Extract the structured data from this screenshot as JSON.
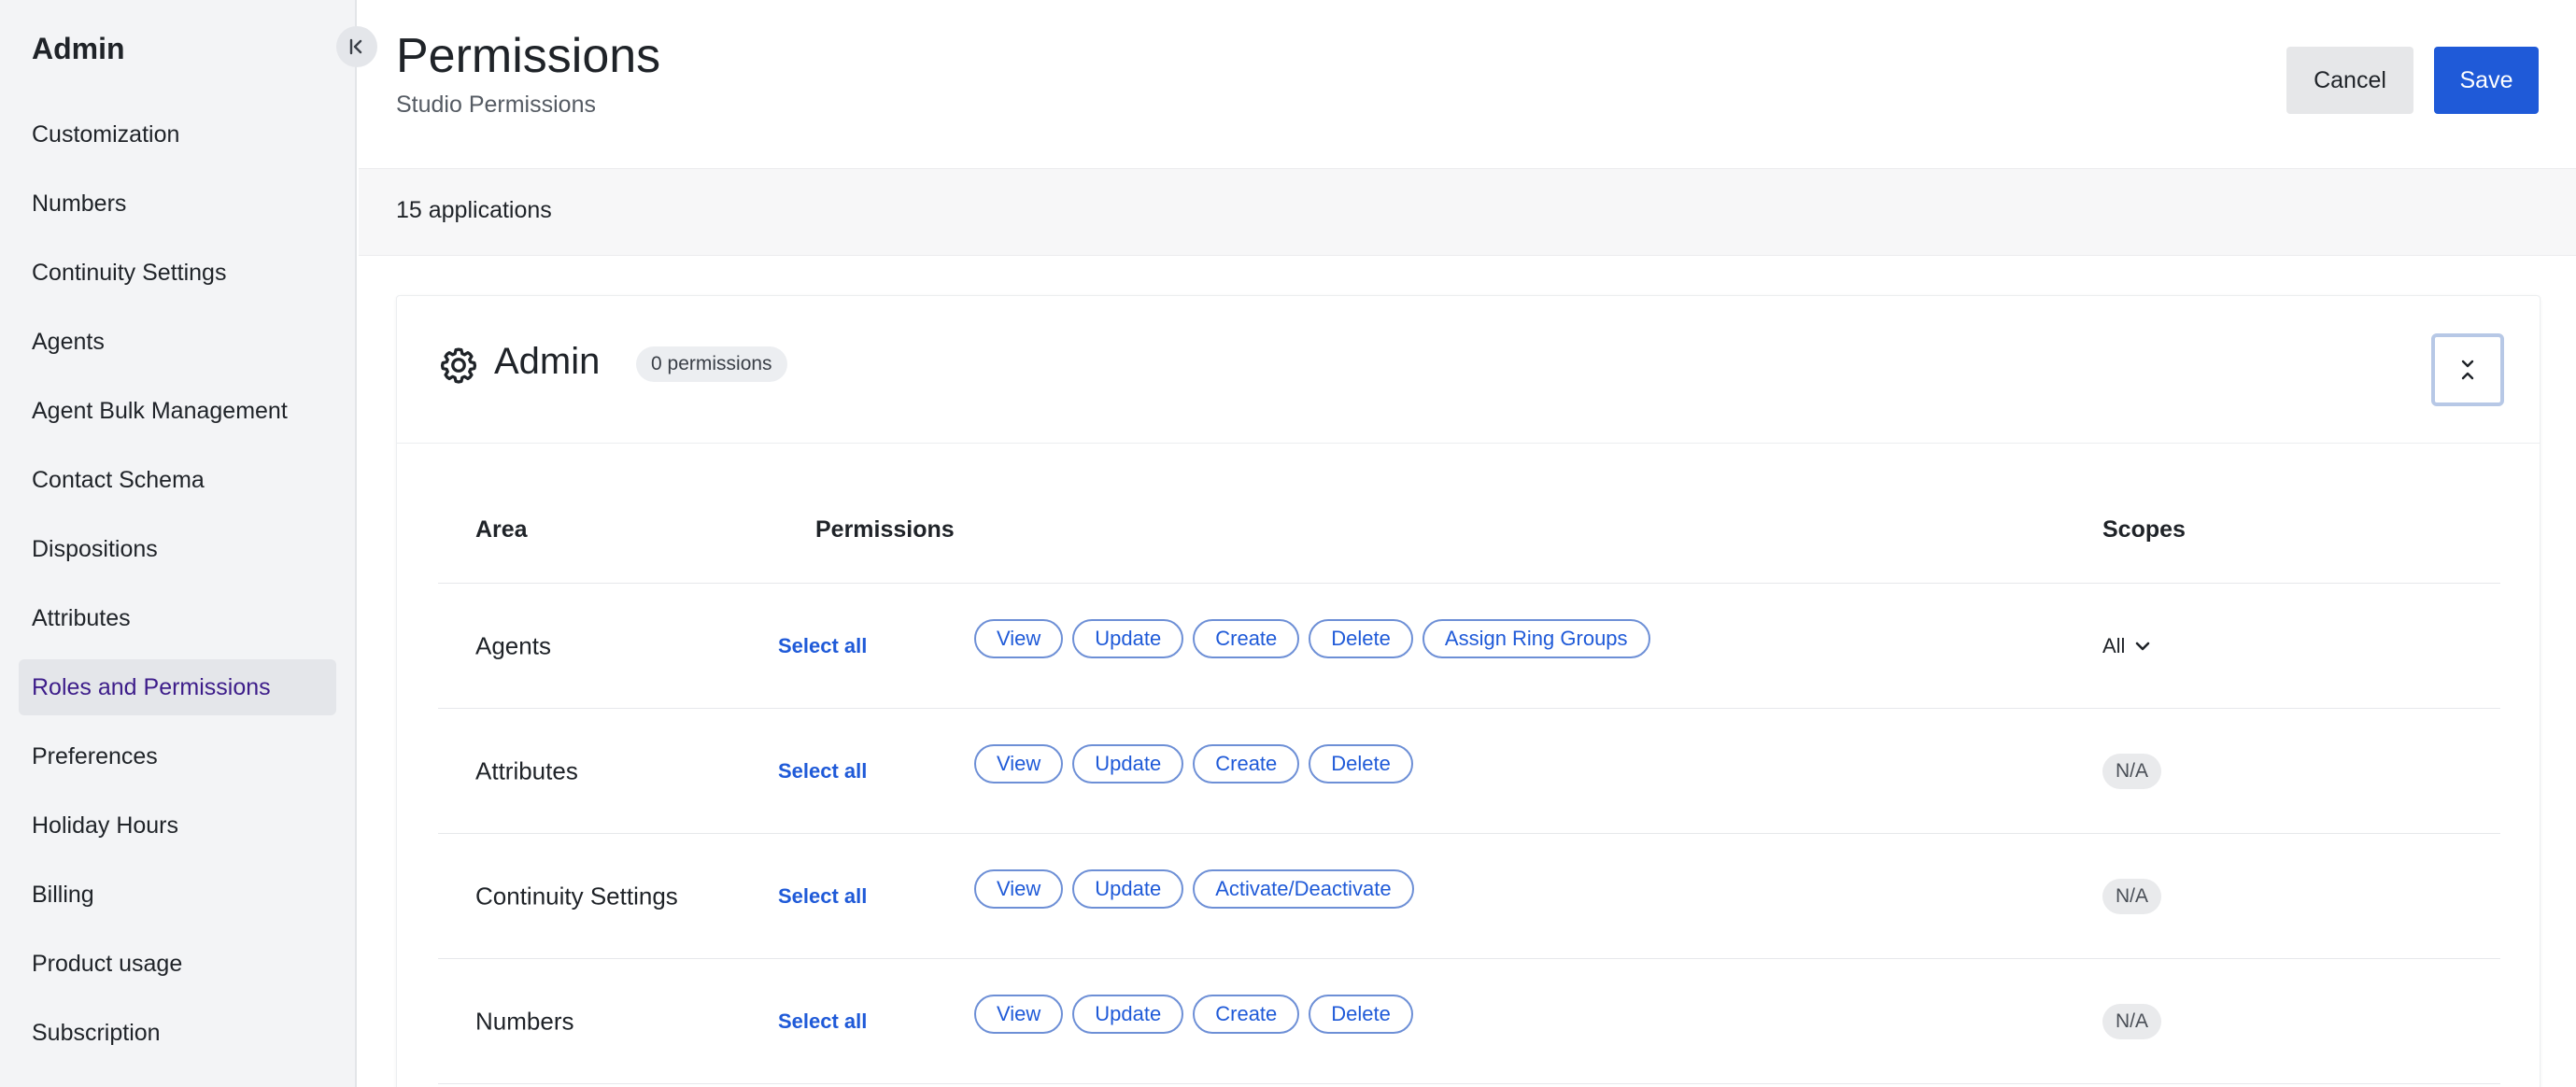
{
  "sidebar": {
    "title": "Admin",
    "items": [
      {
        "label": "Customization"
      },
      {
        "label": "Numbers"
      },
      {
        "label": "Continuity Settings"
      },
      {
        "label": "Agents"
      },
      {
        "label": "Agent Bulk Management"
      },
      {
        "label": "Contact Schema"
      },
      {
        "label": "Dispositions"
      },
      {
        "label": "Attributes"
      },
      {
        "label": "Roles and Permissions",
        "active": true
      },
      {
        "label": "Preferences"
      },
      {
        "label": "Holiday Hours"
      },
      {
        "label": "Billing"
      },
      {
        "label": "Product usage"
      },
      {
        "label": "Subscription"
      }
    ]
  },
  "header": {
    "title": "Permissions",
    "subtitle": "Studio Permissions",
    "cancel_label": "Cancel",
    "save_label": "Save"
  },
  "applications": {
    "count_label": "15 applications"
  },
  "card": {
    "icon": "gear-icon",
    "title": "Admin",
    "badge": "0 permissions",
    "columns": {
      "area": "Area",
      "permissions": "Permissions",
      "scopes": "Scopes"
    },
    "rows": [
      {
        "area": "Agents",
        "select_all": "Select all",
        "permissions": [
          "View",
          "Update",
          "Create",
          "Delete",
          "Assign Ring Groups"
        ],
        "scope": "All",
        "scope_type": "dropdown"
      },
      {
        "area": "Attributes",
        "select_all": "Select all",
        "permissions": [
          "View",
          "Update",
          "Create",
          "Delete"
        ],
        "scope": "N/A",
        "scope_type": "badge"
      },
      {
        "area": "Continuity Settings",
        "select_all": "Select all",
        "permissions": [
          "View",
          "Update",
          "Activate/Deactivate"
        ],
        "scope": "N/A",
        "scope_type": "badge"
      },
      {
        "area": "Numbers",
        "select_all": "Select all",
        "permissions": [
          "View",
          "Update",
          "Create",
          "Delete"
        ],
        "scope": "N/A",
        "scope_type": "badge"
      }
    ]
  },
  "colors": {
    "accent": "#1f5ad8",
    "active_nav_text": "#3d1d8a"
  }
}
